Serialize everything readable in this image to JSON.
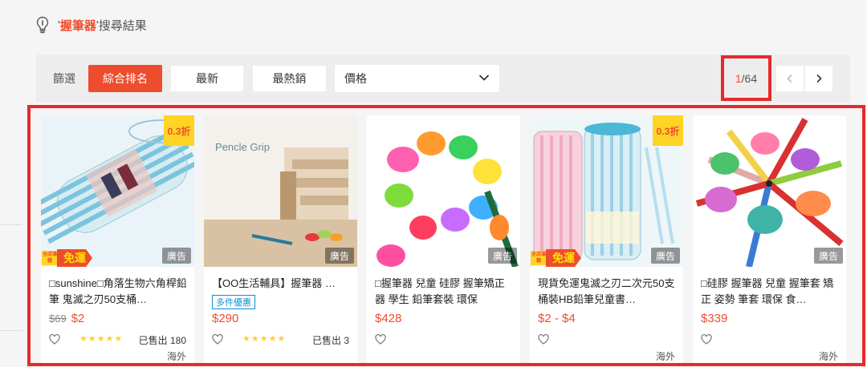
{
  "search": {
    "quote_open": "'",
    "query": "握筆器",
    "quote_close": "'",
    "suffix": "搜尋結果"
  },
  "filter_bar": {
    "label": "篩選",
    "sort_options": [
      "綜合排名",
      "最新",
      "最熱銷"
    ],
    "active_sort": "綜合排名",
    "price_label": "價格"
  },
  "pagination": {
    "current": "1",
    "separator": "/",
    "total": "64"
  },
  "colors": {
    "accent": "#ee4d2d",
    "highlight_frame": "#e8292b",
    "star": "#ffce3d"
  },
  "products": [
    {
      "title": "□sunshine□角落生物六角桿鉛筆 鬼滅之刃50支桶…",
      "discount": "0.3折",
      "ad": "廣告",
      "free_shipping": {
        "small": "全店滿額",
        "main": "免運"
      },
      "original_price": "$69",
      "price": "$2",
      "rating_stars": 5,
      "sold": "已售出 180",
      "location": "海外"
    },
    {
      "title": "【OO生活輔具】握筆器 …",
      "image_text": "Pencle Grip",
      "ad": "廣告",
      "badge": "多件優惠",
      "price": "$290",
      "rating_stars": 5,
      "sold": "已售出 3"
    },
    {
      "title": "□握筆器 兒童 硅膠 握筆矯正器 學生 鉛筆套裝 環保",
      "ad": "廣告",
      "price": "$428"
    },
    {
      "title": "現貨免運鬼滅之刃二次元50支桶裝HB鉛筆兒童書…",
      "discount": "0.3折",
      "ad": "廣告",
      "free_shipping": {
        "small": "全店滿額",
        "main": "免運"
      },
      "price": "$2 - $4",
      "location": "海外"
    },
    {
      "title": "□硅膠 握筆器 兒童 握筆套 矯正 姿勢 筆套 環保 食…",
      "ad": "廣告",
      "price": "$339",
      "location": "海外"
    }
  ]
}
